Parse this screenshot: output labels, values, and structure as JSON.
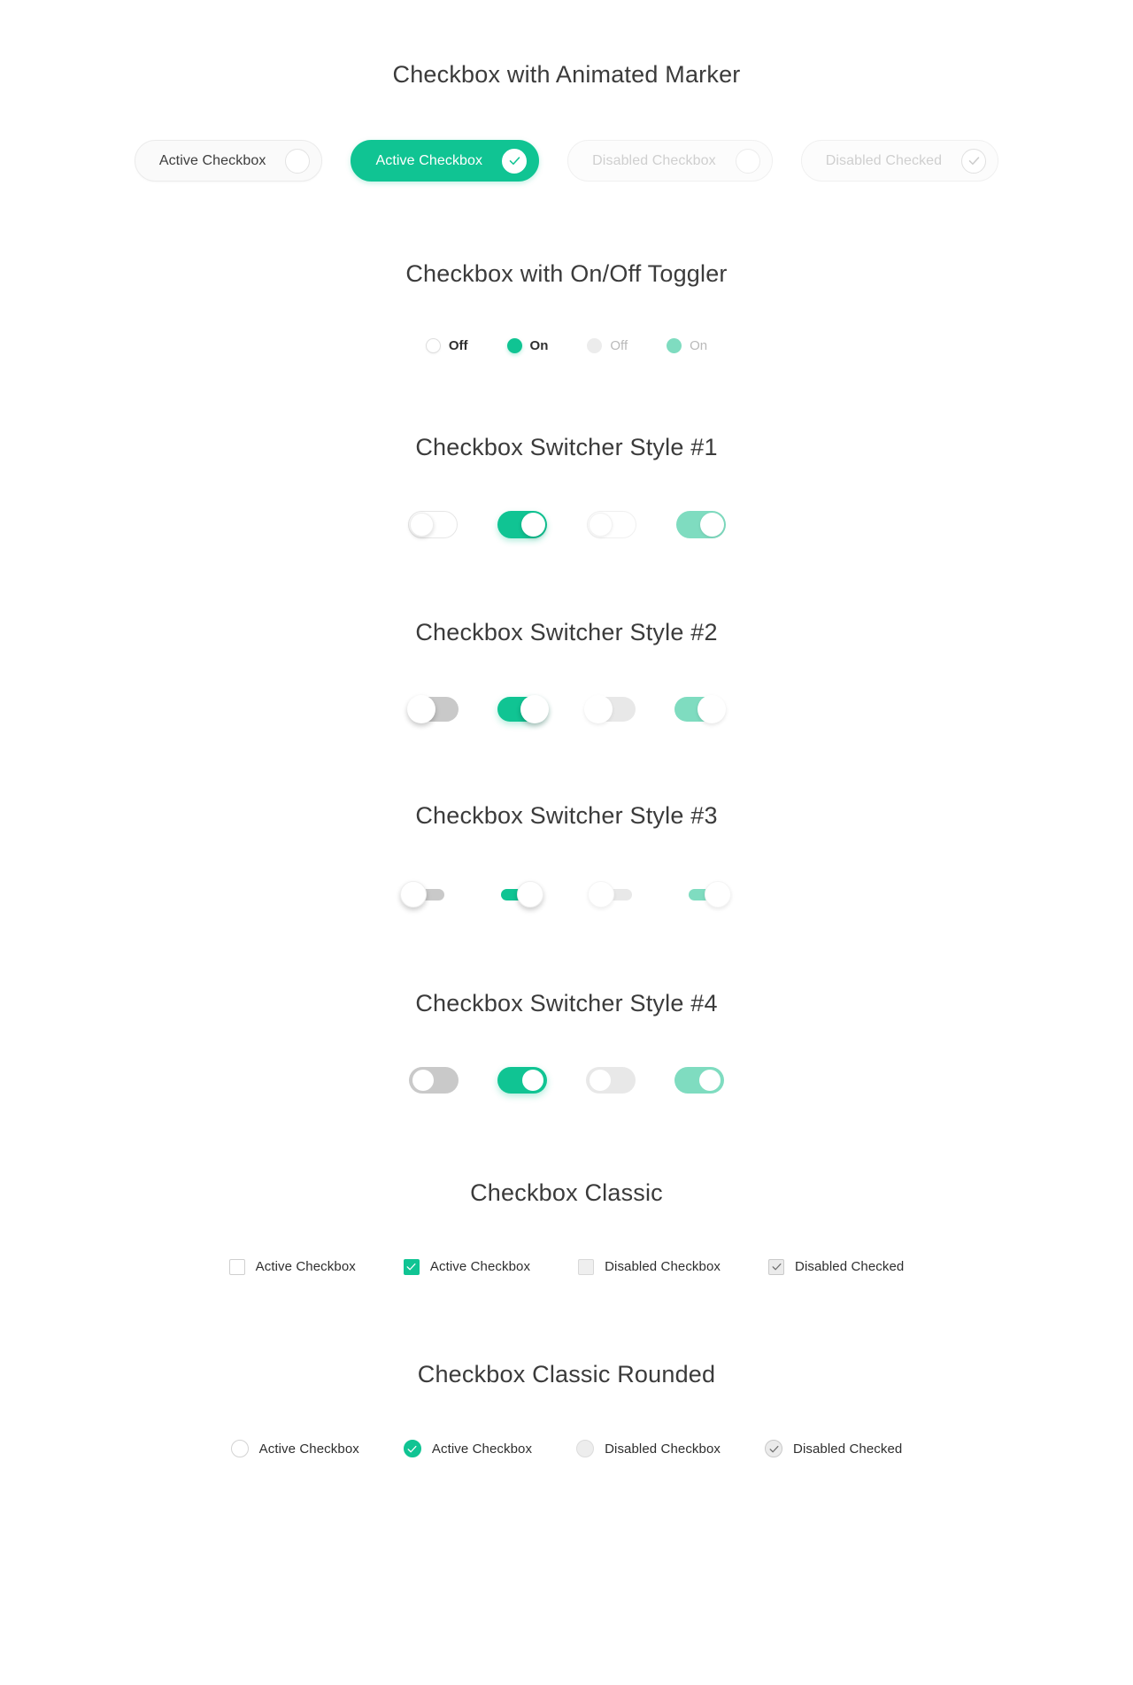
{
  "theme": {
    "accent_green": "#10c493",
    "accent_green_light": "#7fdcc0",
    "text_dark": "#2e2e2e",
    "text_muted": "#b9b9b9",
    "background": "#ffffff"
  },
  "sections": {
    "animated_marker": {
      "title": "Checkbox with Animated Marker",
      "items": [
        {
          "label": "Active Checkbox",
          "state": "active",
          "checked": false,
          "disabled": false
        },
        {
          "label": "Active Checkbox",
          "state": "checked",
          "checked": true,
          "disabled": false
        },
        {
          "label": "Disabled Checkbox",
          "state": "disabled",
          "checked": false,
          "disabled": true
        },
        {
          "label": "Disabled Checked",
          "state": "disabled-checked",
          "checked": true,
          "disabled": true
        }
      ]
    },
    "on_off_toggler": {
      "title": "Checkbox with On/Off Toggler",
      "items": [
        {
          "label": "Off",
          "state": "off-on",
          "checked": false,
          "disabled": false
        },
        {
          "label": "On",
          "state": "on-on",
          "checked": true,
          "disabled": false
        },
        {
          "label": "Off",
          "state": "off-dis",
          "checked": false,
          "disabled": true
        },
        {
          "label": "On",
          "state": "on-dis",
          "checked": true,
          "disabled": true
        }
      ]
    },
    "switcher_1": {
      "title": "Checkbox Switcher Style #1",
      "items": [
        {
          "state": "s-off",
          "checked": false,
          "disabled": false
        },
        {
          "state": "s-on",
          "checked": true,
          "disabled": false
        },
        {
          "state": "s-offd",
          "checked": false,
          "disabled": true
        },
        {
          "state": "s-ond",
          "checked": true,
          "disabled": true
        }
      ]
    },
    "switcher_2": {
      "title": "Checkbox Switcher Style #2",
      "items": [
        {
          "state": "s-off",
          "checked": false,
          "disabled": false
        },
        {
          "state": "s-on",
          "checked": true,
          "disabled": false
        },
        {
          "state": "s-offd",
          "checked": false,
          "disabled": true
        },
        {
          "state": "s-ond",
          "checked": true,
          "disabled": true
        }
      ]
    },
    "switcher_3": {
      "title": "Checkbox Switcher Style #3",
      "items": [
        {
          "state": "s-off",
          "checked": false,
          "disabled": false
        },
        {
          "state": "s-on",
          "checked": true,
          "disabled": false
        },
        {
          "state": "s-offd",
          "checked": false,
          "disabled": true
        },
        {
          "state": "s-ond",
          "checked": true,
          "disabled": true
        }
      ]
    },
    "switcher_4": {
      "title": "Checkbox Switcher Style #4",
      "items": [
        {
          "state": "s-off",
          "checked": false,
          "disabled": false
        },
        {
          "state": "s-on",
          "checked": true,
          "disabled": false
        },
        {
          "state": "s-offd",
          "checked": false,
          "disabled": true
        },
        {
          "state": "s-ond",
          "checked": true,
          "disabled": true
        }
      ]
    },
    "classic": {
      "title": "Checkbox Classic",
      "items": [
        {
          "label": "Active Checkbox",
          "state": "b-off",
          "checked": false,
          "disabled": false
        },
        {
          "label": "Active Checkbox",
          "state": "b-on",
          "checked": true,
          "disabled": false
        },
        {
          "label": "Disabled Checkbox",
          "state": "b-offd",
          "checked": false,
          "disabled": true
        },
        {
          "label": "Disabled Checked",
          "state": "b-ond",
          "checked": true,
          "disabled": true
        }
      ]
    },
    "classic_rounded": {
      "title": "Checkbox Classic Rounded",
      "items": [
        {
          "label": "Active Checkbox",
          "state": "b-off",
          "checked": false,
          "disabled": false
        },
        {
          "label": "Active Checkbox",
          "state": "b-on",
          "checked": true,
          "disabled": false
        },
        {
          "label": "Disabled Checkbox",
          "state": "b-offd",
          "checked": false,
          "disabled": true
        },
        {
          "label": "Disabled Checked",
          "state": "b-ond",
          "checked": true,
          "disabled": true
        }
      ]
    }
  },
  "icons": {
    "check": "check-icon"
  }
}
